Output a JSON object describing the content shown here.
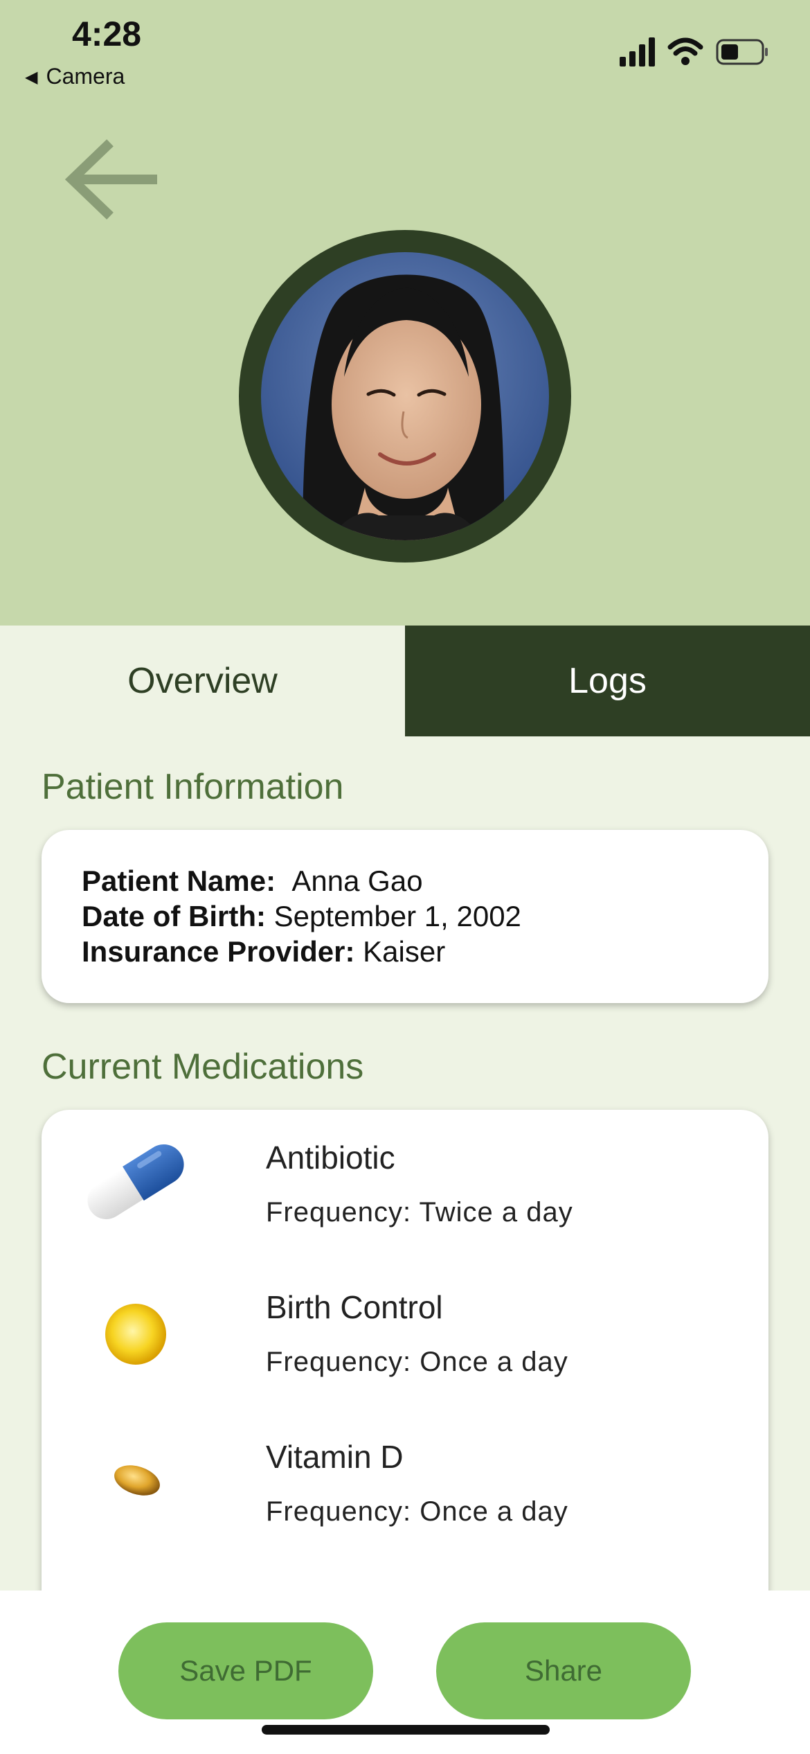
{
  "status_bar": {
    "time": "4:28",
    "back_label": "Camera"
  },
  "tabs": [
    {
      "label": "Overview"
    },
    {
      "label": "Logs"
    }
  ],
  "patient_section": {
    "title": "Patient Information",
    "name_label": "Patient Name:",
    "name_value": "Anna Gao",
    "dob_label": "Date of Birth:",
    "dob_value": "September 1, 2002",
    "insurance_label": "Insurance Provider:",
    "insurance_value": "Kaiser"
  },
  "medications_section": {
    "title": "Current Medications",
    "items": [
      {
        "name": "Antibiotic",
        "frequency": "Frequency: Twice a day",
        "icon": "capsule-icon"
      },
      {
        "name": "Birth Control",
        "frequency": "Frequency: Once a day",
        "icon": "yellow-pill-icon"
      },
      {
        "name": "Vitamin D",
        "frequency": "Frequency: Once a day",
        "icon": "softgel-icon"
      }
    ]
  },
  "actions": {
    "save_pdf_label": "Save PDF",
    "share_label": "Share"
  },
  "colors": {
    "header_bg": "#c6d8ab",
    "dark_green": "#2e3f24",
    "accent_green": "#7dbf5c",
    "section_title": "#4e6f3a"
  }
}
